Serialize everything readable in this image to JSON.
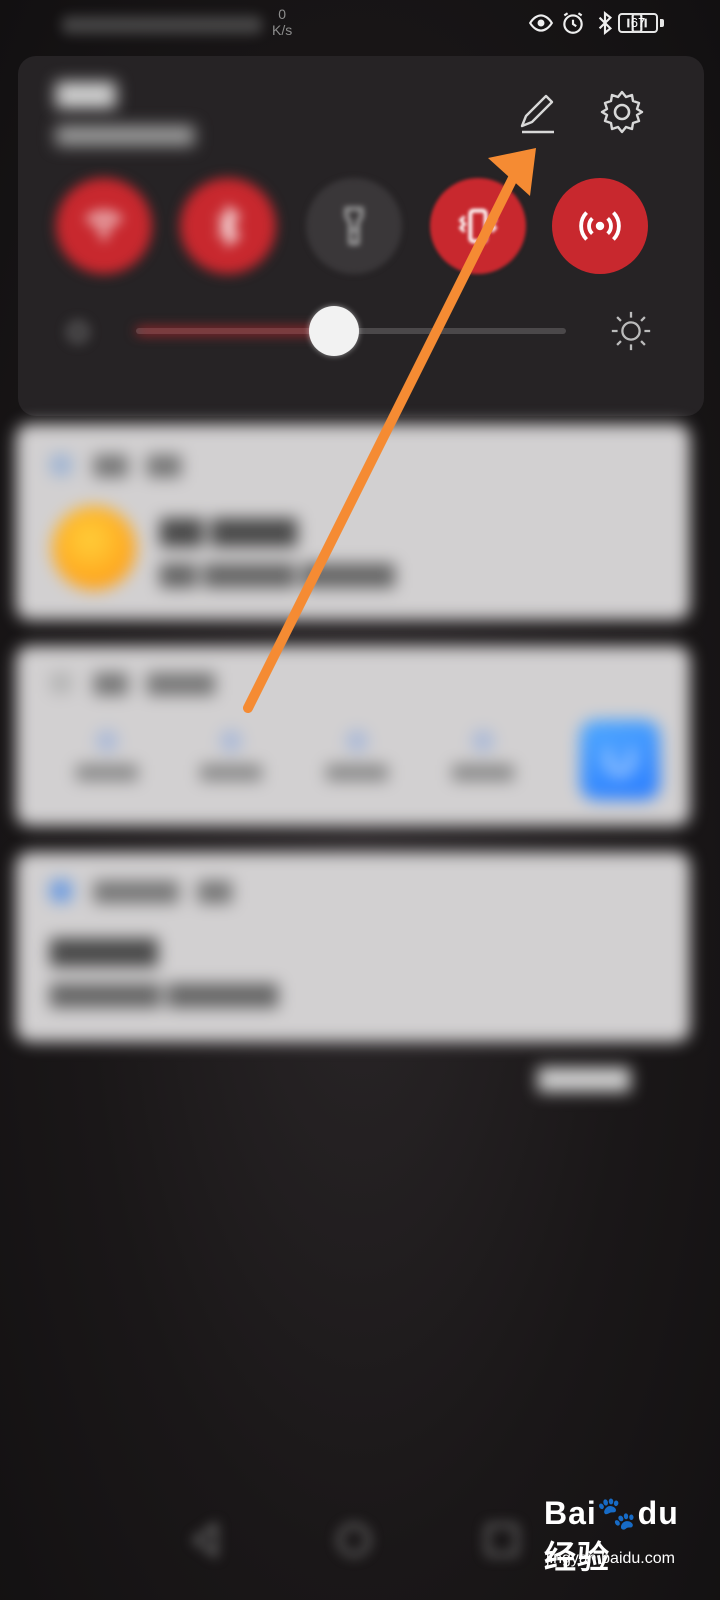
{
  "status_bar": {
    "net_speed_value": "0",
    "net_speed_unit": "K/s",
    "battery_level": "67",
    "icons": [
      "eye-icon",
      "alarm-icon",
      "bluetooth-icon",
      "vibrate-icon",
      "battery-icon"
    ]
  },
  "panel": {
    "toggles": [
      {
        "name": "wifi",
        "state": "on"
      },
      {
        "name": "bluetooth",
        "state": "on"
      },
      {
        "name": "flashlight",
        "state": "off"
      },
      {
        "name": "vibrate",
        "state": "on"
      },
      {
        "name": "hotspot",
        "state": "on"
      }
    ],
    "brightness_level": 0.46
  },
  "annotation": {
    "arrow_color": "#f58b33"
  },
  "colors": {
    "accent": "#c8282e",
    "panel": "#262325",
    "card": "#d2d0d1"
  },
  "watermark": {
    "logo_text": "Bai",
    "logo_text_2": "du",
    "logo_suffix": "经验",
    "url": "jingyan.baidu.com"
  }
}
